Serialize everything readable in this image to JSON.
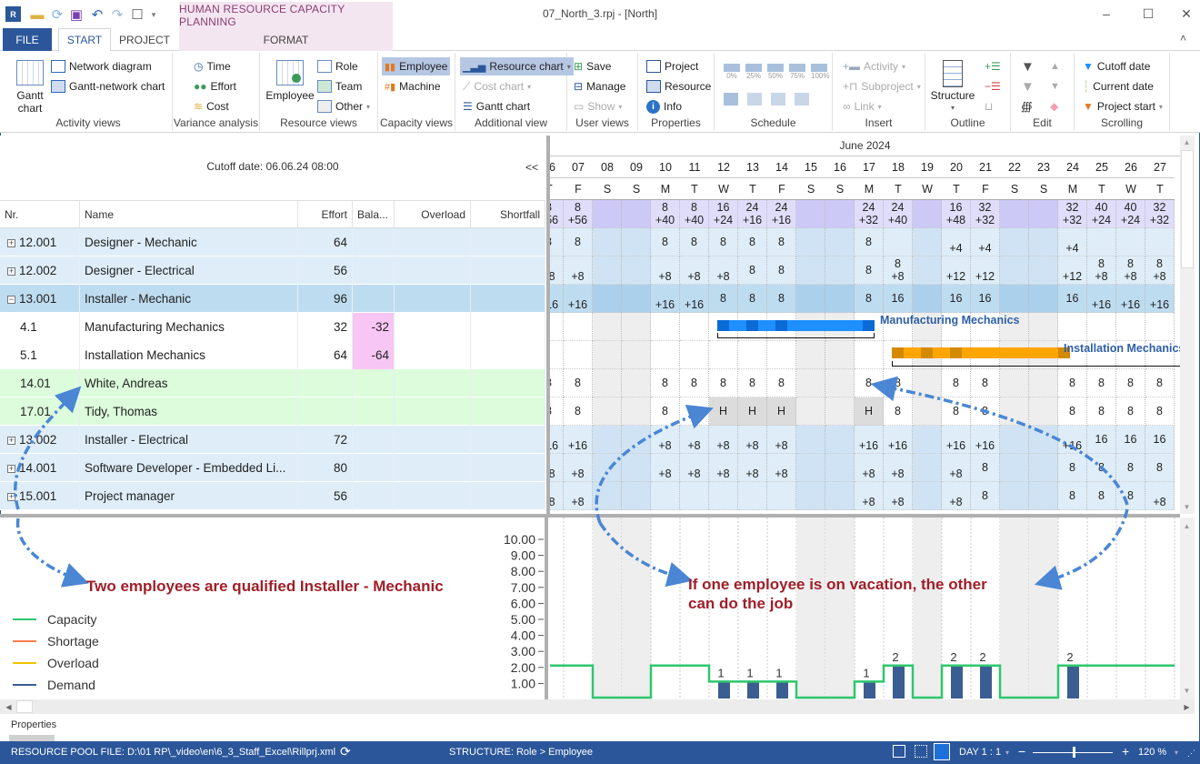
{
  "window": {
    "title": "07_North_3.rpj - [North]",
    "context_tab_group": "HUMAN RESOURCE CAPACITY PLANNING",
    "controls": {
      "minimize": "–",
      "maximize": "☐",
      "close": "✕"
    }
  },
  "quick_access": [
    "app-icon",
    "open-folder-icon",
    "refresh-icon",
    "save-icon",
    "undo-icon",
    "redo-icon",
    "window-icon",
    "customize-icon"
  ],
  "tabs": [
    {
      "label": "FILE"
    },
    {
      "label": "START",
      "active": true
    },
    {
      "label": "PROJECT"
    },
    {
      "label": "FORMAT"
    }
  ],
  "ribbon": {
    "collapse_glyph": "˄",
    "groups": {
      "activity_views": {
        "label": "Activity views",
        "gantt": "Gantt chart",
        "network": "Network diagram",
        "gantt_network": "Gantt-network chart"
      },
      "variance": {
        "label": "Variance analysis",
        "time": "Time",
        "effort": "Effort",
        "cost": "Cost"
      },
      "resource_views": {
        "label": "Resource views",
        "employee": "Employee",
        "role": "Role",
        "team": "Team",
        "other": "Other"
      },
      "capacity_views": {
        "label": "Capacity views",
        "employee": "Employee",
        "machine": "Machine"
      },
      "additional": {
        "label": "Additional view",
        "resource_chart": "Resource chart",
        "cost_chart": "Cost chart",
        "gantt_chart": "Gantt chart"
      },
      "user_views": {
        "label": "User views",
        "save": "Save",
        "manage": "Manage",
        "show": "Show"
      },
      "properties": {
        "label": "Properties",
        "project": "Project",
        "resource": "Resource",
        "info": "Info"
      },
      "schedule": {
        "label": "Schedule",
        "progress": [
          "0%",
          "25%",
          "50%",
          "75%",
          "100%"
        ]
      },
      "insert": {
        "label": "Insert",
        "activity": "Activity",
        "subproject": "Subproject",
        "link": "Link"
      },
      "outline": {
        "label": "Outline",
        "structure": "Structure"
      },
      "edit": {
        "label": "Edit"
      },
      "scrolling": {
        "label": "Scrolling",
        "cutoff": "Cutoff date",
        "current": "Current date",
        "project_start": "Project start"
      }
    }
  },
  "grid": {
    "cutoff_label": "Cutoff date: 06.06.24 08:00",
    "collapse_label": "<<",
    "columns": [
      "Nr.",
      "Name",
      "Effort",
      "Bala...",
      "Overload",
      "Shortfall"
    ],
    "rows": [
      {
        "nr": "12.001",
        "name": "Designer - Mechanic",
        "effort": "64",
        "balance": "",
        "type": "role",
        "expand": "+"
      },
      {
        "nr": "12.002",
        "name": "Designer - Electrical",
        "effort": "56",
        "balance": "",
        "type": "role",
        "expand": "+"
      },
      {
        "nr": "13.001",
        "name": "Installer - Mechanic",
        "effort": "96",
        "balance": "",
        "type": "selected",
        "expand": "−"
      },
      {
        "nr": "4.1",
        "name": "Manufacturing Mechanics",
        "effort": "32",
        "balance": "-32",
        "type": "activity",
        "expand": ""
      },
      {
        "nr": "5.1",
        "name": "Installation Mechanics",
        "effort": "64",
        "balance": "-64",
        "type": "activity",
        "expand": ""
      },
      {
        "nr": "14.01",
        "name": "White, Andreas",
        "effort": "",
        "balance": "",
        "type": "employee",
        "expand": ""
      },
      {
        "nr": "17.01",
        "name": "Tidy, Thomas",
        "effort": "",
        "balance": "",
        "type": "employee",
        "expand": ""
      },
      {
        "nr": "13.002",
        "name": "Installer - Electrical",
        "effort": "72",
        "balance": "",
        "type": "role",
        "expand": "+"
      },
      {
        "nr": "14.001",
        "name": "Software Developer - Embedded Li...",
        "effort": "80",
        "balance": "",
        "type": "role",
        "expand": "+"
      },
      {
        "nr": "15.001",
        "name": "Project manager",
        "effort": "56",
        "balance": "",
        "type": "role",
        "expand": "+"
      }
    ]
  },
  "timeline": {
    "month": "June 2024",
    "days": [
      {
        "d": "06",
        "w": "T",
        "we": false
      },
      {
        "d": "07",
        "w": "F",
        "we": false
      },
      {
        "d": "08",
        "w": "S",
        "we": true
      },
      {
        "d": "09",
        "w": "S",
        "we": true
      },
      {
        "d": "10",
        "w": "M",
        "we": false
      },
      {
        "d": "11",
        "w": "T",
        "we": false
      },
      {
        "d": "12",
        "w": "W",
        "we": false
      },
      {
        "d": "13",
        "w": "T",
        "we": false
      },
      {
        "d": "14",
        "w": "F",
        "we": false
      },
      {
        "d": "15",
        "w": "S",
        "we": true
      },
      {
        "d": "16",
        "w": "S",
        "we": true
      },
      {
        "d": "17",
        "w": "M",
        "we": false
      },
      {
        "d": "18",
        "w": "T",
        "we": false
      },
      {
        "d": "19",
        "w": "W",
        "we": true
      },
      {
        "d": "20",
        "w": "T",
        "we": false
      },
      {
        "d": "21",
        "w": "F",
        "we": false
      },
      {
        "d": "22",
        "w": "S",
        "we": true
      },
      {
        "d": "23",
        "w": "S",
        "we": true
      },
      {
        "d": "24",
        "w": "M",
        "we": false
      },
      {
        "d": "25",
        "w": "T",
        "we": false
      },
      {
        "d": "26",
        "w": "W",
        "we": false
      },
      {
        "d": "27",
        "w": "T",
        "we": false
      }
    ],
    "summary": [
      [
        "8",
        "+56"
      ],
      [
        "8",
        "+56"
      ],
      null,
      null,
      [
        "8",
        "+40"
      ],
      [
        "8",
        "+40"
      ],
      [
        "16",
        "+24"
      ],
      [
        "24",
        "+16"
      ],
      [
        "24",
        "+16"
      ],
      null,
      null,
      [
        "24",
        "+32"
      ],
      [
        "24",
        "+40"
      ],
      null,
      [
        "16",
        "+48"
      ],
      [
        "32",
        "+32"
      ],
      null,
      null,
      [
        "32",
        "+32"
      ],
      [
        "40",
        "+24"
      ],
      [
        "40",
        "+24"
      ],
      [
        "32",
        "+32"
      ]
    ],
    "rows": [
      [
        [
          "8"
        ],
        [
          "8"
        ],
        null,
        null,
        [
          "8"
        ],
        [
          "8"
        ],
        [
          "8"
        ],
        [
          "8"
        ],
        [
          "8"
        ],
        null,
        null,
        [
          "8"
        ],
        [
          ""
        ],
        null,
        [
          "",
          "+4"
        ],
        [
          "",
          "+4"
        ],
        null,
        null,
        [
          "",
          "+4"
        ],
        [
          ""
        ],
        [
          ""
        ],
        [
          ""
        ]
      ],
      [
        [
          "",
          "+8"
        ],
        [
          "",
          "+8"
        ],
        null,
        null,
        [
          "",
          "+8"
        ],
        [
          "",
          "+8"
        ],
        [
          "",
          "+8"
        ],
        [
          "8"
        ],
        [
          "8"
        ],
        null,
        null,
        [
          "8"
        ],
        [
          "8",
          "+8"
        ],
        null,
        [
          "",
          "+12"
        ],
        [
          "",
          "+12"
        ],
        null,
        null,
        [
          "",
          "+12"
        ],
        [
          "8",
          "+8"
        ],
        [
          "8",
          "+8"
        ],
        [
          "8",
          "+8"
        ]
      ],
      [
        [
          "",
          "+16"
        ],
        [
          "",
          "+16"
        ],
        null,
        null,
        [
          "",
          "+16"
        ],
        [
          "",
          "+16"
        ],
        [
          "8"
        ],
        [
          "8"
        ],
        [
          "8"
        ],
        null,
        null,
        [
          "8"
        ],
        [
          "16"
        ],
        null,
        [
          "16"
        ],
        [
          "16"
        ],
        null,
        null,
        [
          "16"
        ],
        [
          "",
          "+16"
        ],
        [
          "",
          "+16"
        ],
        [
          "",
          "+16"
        ]
      ],
      "bar",
      "bar",
      [
        [
          "8"
        ],
        [
          "8"
        ],
        null,
        null,
        [
          "8"
        ],
        [
          "8"
        ],
        [
          "8"
        ],
        [
          "8"
        ],
        [
          "8"
        ],
        null,
        null,
        [
          "8"
        ],
        [
          "8"
        ],
        null,
        [
          "8"
        ],
        [
          "8"
        ],
        null,
        null,
        [
          "8"
        ],
        [
          "8"
        ],
        [
          "8"
        ],
        [
          "8"
        ]
      ],
      [
        [
          "8"
        ],
        [
          "8"
        ],
        null,
        null,
        [
          "8"
        ],
        [
          "8"
        ],
        [
          "H"
        ],
        [
          "H"
        ],
        [
          "H"
        ],
        null,
        null,
        [
          "H"
        ],
        [
          "8"
        ],
        null,
        [
          "8"
        ],
        [
          "8"
        ],
        null,
        null,
        [
          "8"
        ],
        [
          "8"
        ],
        [
          "8"
        ],
        [
          "8"
        ]
      ],
      [
        [
          "",
          "+16"
        ],
        [
          "",
          "+16"
        ],
        null,
        null,
        [
          "",
          "+8"
        ],
        [
          "",
          "+8"
        ],
        [
          "",
          "+8"
        ],
        [
          "",
          "+8"
        ],
        [
          "",
          "+8"
        ],
        null,
        null,
        [
          "",
          "+16"
        ],
        [
          "",
          "+16"
        ],
        null,
        [
          "",
          "+16"
        ],
        [
          "",
          "+16"
        ],
        null,
        null,
        [
          "",
          "+16"
        ],
        [
          "16"
        ],
        [
          "16"
        ],
        [
          "16"
        ]
      ],
      [
        [
          "",
          "+8"
        ],
        [
          "",
          "+8"
        ],
        null,
        null,
        [
          "",
          "+8"
        ],
        [
          "",
          "+8"
        ],
        [
          "",
          "+8"
        ],
        [
          "",
          "+8"
        ],
        [
          "",
          "+8"
        ],
        null,
        null,
        [
          "",
          "+8"
        ],
        [
          "",
          "+8"
        ],
        null,
        [
          "",
          "+8"
        ],
        [
          "8"
        ],
        null,
        null,
        [
          "8"
        ],
        [
          "8"
        ],
        [
          "8"
        ],
        [
          "8"
        ]
      ],
      [
        [
          "",
          "+8"
        ],
        [
          "",
          "+8"
        ],
        null,
        null,
        [
          ""
        ],
        [
          ""
        ],
        [
          ""
        ],
        [
          ""
        ],
        [
          ""
        ],
        null,
        null,
        [
          "",
          "+8"
        ],
        [
          "",
          "+8"
        ],
        null,
        [
          "",
          "+8"
        ],
        [
          "8"
        ],
        null,
        null,
        [
          "8"
        ],
        [
          "8"
        ],
        [
          "8"
        ],
        [
          "",
          "+8"
        ]
      ]
    ],
    "bars": [
      {
        "label": "Manufacturing Mechanics",
        "color": "#1e8fff",
        "dark": "#0a6ad6",
        "start_day": "12",
        "end_day": "17"
      },
      {
        "label": "Installation Mechanics",
        "color": "#ffa500",
        "dark": "#d48a00",
        "start_day": "18",
        "end_day": "24"
      }
    ]
  },
  "chart_data": {
    "type": "bar",
    "title": "",
    "xlabel": "",
    "ylabel": "",
    "ylim": [
      0,
      10
    ],
    "yticks": [
      "10.00",
      "9.00",
      "8.00",
      "7.00",
      "6.00",
      "5.00",
      "4.00",
      "3.00",
      "2.00",
      "1.00"
    ],
    "categories": [
      "06",
      "07",
      "08",
      "09",
      "10",
      "11",
      "12",
      "13",
      "14",
      "15",
      "16",
      "17",
      "18",
      "19",
      "20",
      "21",
      "22",
      "23",
      "24",
      "25",
      "26",
      "27"
    ],
    "series": [
      {
        "name": "Capacity",
        "type": "step-line",
        "color": "#2dc76d",
        "values": [
          2,
          2,
          0,
          0,
          2,
          2,
          1,
          1,
          1,
          0,
          0,
          1,
          2,
          0,
          2,
          2,
          0,
          0,
          2,
          2,
          2,
          2
        ]
      },
      {
        "name": "Demand",
        "type": "bar",
        "color": "#3b5e92",
        "values": [
          0,
          0,
          0,
          0,
          0,
          0,
          1,
          1,
          1,
          0,
          0,
          1,
          2,
          0,
          2,
          2,
          0,
          0,
          2,
          0,
          0,
          0
        ]
      }
    ],
    "data_labels": [
      {
        "day": "12",
        "text": "1"
      },
      {
        "day": "13",
        "text": "1"
      },
      {
        "day": "14",
        "text": "1"
      },
      {
        "day": "17",
        "text": "1"
      },
      {
        "day": "18",
        "text": "2"
      },
      {
        "day": "20",
        "text": "2"
      },
      {
        "day": "21",
        "text": "2"
      },
      {
        "day": "24",
        "text": "2"
      }
    ],
    "legend": [
      {
        "name": "Capacity",
        "color": "#2dc76d"
      },
      {
        "name": "Shortage",
        "color": "#ff7f50"
      },
      {
        "name": "Overload",
        "color": "#f2c200"
      },
      {
        "name": "Demand",
        "color": "#3b5e92"
      }
    ],
    "legend_position": "left",
    "grid": true
  },
  "annotations": {
    "left": "Two employees are qualified Installer - Mechanic",
    "right_line1": "If one employee is on vacation, the other",
    "right_line2": "can do the job"
  },
  "properties_label": "Properties",
  "status": {
    "pool_file": "RESOURCE POOL FILE: D:\\01 RP\\_video\\en\\6_3_Staff_Excel\\Rillprj.xml",
    "structure": "STRUCTURE: Role > Employee",
    "scale": "DAY 1 : 1",
    "zoom": "120 %",
    "zoom_value_percent": 120
  }
}
